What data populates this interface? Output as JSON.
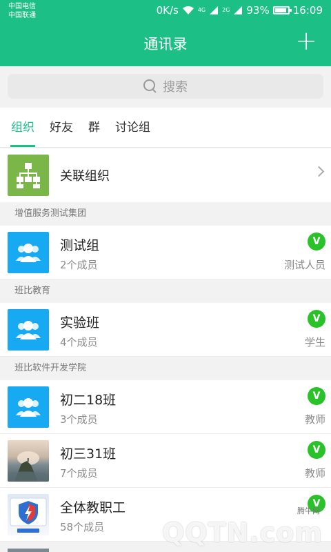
{
  "status": {
    "carrier1": "中国电信",
    "carrier2": "中国联通",
    "speed": "0K/s",
    "net1": "4G",
    "net2": "2G",
    "battery": "93%",
    "time": "16:09"
  },
  "header": {
    "title": "通讯录",
    "add_label": "+"
  },
  "search": {
    "placeholder": "搜索"
  },
  "tabs": [
    {
      "label": "组织",
      "active": true
    },
    {
      "label": "好友",
      "active": false
    },
    {
      "label": "群",
      "active": false
    },
    {
      "label": "讨论组",
      "active": false
    }
  ],
  "related": {
    "label": "关联组织",
    "icon": "org-chart-icon"
  },
  "sections": [
    {
      "title": "增值服务测试集团",
      "groups": [
        {
          "name": "测试组",
          "count": "2个成员",
          "badge": "V",
          "role": "测试人员",
          "avatar": "group-icon"
        }
      ]
    },
    {
      "title": "班比教育",
      "groups": [
        {
          "name": "实验班",
          "count": "4个成员",
          "badge": "V",
          "role": "学生",
          "avatar": "group-icon"
        }
      ]
    },
    {
      "title": "班比软件开发学院",
      "groups": [
        {
          "name": "初二18班",
          "count": "3个成员",
          "badge": "V",
          "role": "教师",
          "avatar": "group-icon"
        },
        {
          "name": "初三31班",
          "count": "7个成员",
          "badge": "V",
          "role": "教师",
          "avatar": "landscape-photo"
        },
        {
          "name": "全体教职工",
          "count": "58个成员",
          "badge": "V",
          "role": "",
          "avatar": "shield-app-icon"
        }
      ]
    }
  ],
  "watermark": {
    "text": "QQTN.com",
    "small": "腾牛网"
  },
  "colors": {
    "accent": "#1cbf86",
    "badge": "#2bc12b",
    "group_avatar": "#17a9f2",
    "org_icon": "#7ab648"
  }
}
